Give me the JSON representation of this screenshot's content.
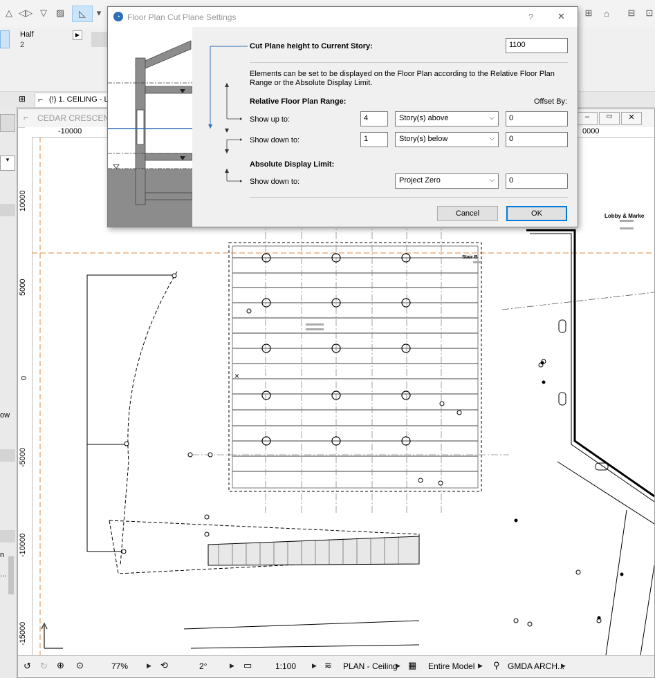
{
  "toolbar": {
    "half_label": "Half",
    "half_value": "2"
  },
  "tab": {
    "title": "(!) 1. CEILING - LE"
  },
  "plan_window": {
    "title": "CEDAR CRESCENT"
  },
  "left_panel": {
    "cut_text_1": "ow",
    "cut_text_2": "n",
    "cut_text_3": "..."
  },
  "rulers": {
    "top_ticks": [
      "-10000",
      "0000"
    ],
    "left_ticks": [
      "10000",
      "5000",
      "0",
      "-5000",
      "-10000",
      "-15000"
    ]
  },
  "plan_labels": {
    "lobby": "Lobby & Marke",
    "stair": "Stair B"
  },
  "statusbar": {
    "zoom": "77%",
    "angle": "2°",
    "scale": "1:100",
    "view": "PLAN - Ceiling",
    "model": "Entire Model",
    "pen_set": "GMDA ARCH..."
  },
  "dialog": {
    "title": "Floor Plan Cut Plane Settings",
    "help": "?",
    "close": "✕",
    "cut_plane_label": "Cut Plane height to Current Story:",
    "cut_plane_value": "1100",
    "description": "Elements can be set to be displayed on the Floor Plan according to the Relative Floor Plan Range or the Absolute Display Limit.",
    "relative_heading": "Relative Floor Plan Range:",
    "offset_heading": "Offset By:",
    "show_up_label": "Show up to:",
    "show_up_count": "4",
    "show_up_option": "Story(s) above",
    "show_up_offset": "0",
    "show_down_label": "Show down to:",
    "show_down_count": "1",
    "show_down_option": "Story(s) below",
    "show_down_offset": "0",
    "absolute_heading": "Absolute Display Limit:",
    "abs_show_down_label": "Show down to:",
    "abs_option": "Project Zero",
    "abs_offset": "0",
    "cancel_label": "Cancel",
    "ok_label": "OK"
  }
}
